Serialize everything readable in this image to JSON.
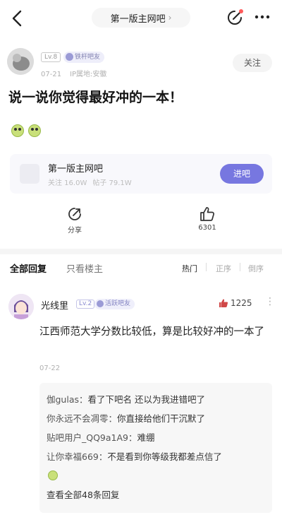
{
  "nav": {
    "forum_title": "第一版主网吧",
    "chevron": "›"
  },
  "post": {
    "author_level": "Lv.8",
    "author_fan_badge": "铁杆吧友",
    "date": "07-21",
    "ip_location": "IP属地:安徽",
    "follow_label": "关注",
    "title": "说一说你觉得最好冲的一本！"
  },
  "forum_card": {
    "name": "第一版主网吧",
    "follows": "关注 16.0W",
    "posts": "帖子 79.1W",
    "enter_label": "进吧"
  },
  "actions": {
    "share_label": "分享",
    "like_count": "6301"
  },
  "tabs": {
    "all_replies": "全部回复",
    "owner_only": "只看楼主",
    "sort_hot": "热门",
    "sort_asc": "正序",
    "sort_desc": "倒序"
  },
  "comment": {
    "username": "光线里",
    "level": "Lv.2",
    "fan_badge": "活跃吧友",
    "likes": "1225",
    "more": "⋮",
    "text": "江西师范大学分数比较低，算是比较好冲的一本了",
    "date": "07-22",
    "replies": [
      {
        "user": "伽gulas：",
        "text": "看了下吧名 还以为我进错吧了"
      },
      {
        "user": "你永远不会凋零：",
        "text": "你直接给他们干沉默了"
      },
      {
        "user": "贴吧用户_QQ9a1A9：",
        "text": "难绷"
      },
      {
        "user": "让你幸福669：",
        "text": "不是看到你等级我都差点信了"
      }
    ],
    "view_all": "查看全部48条回复"
  },
  "colors": {
    "accent": "#7777e0",
    "like_icon": "#d04848"
  }
}
